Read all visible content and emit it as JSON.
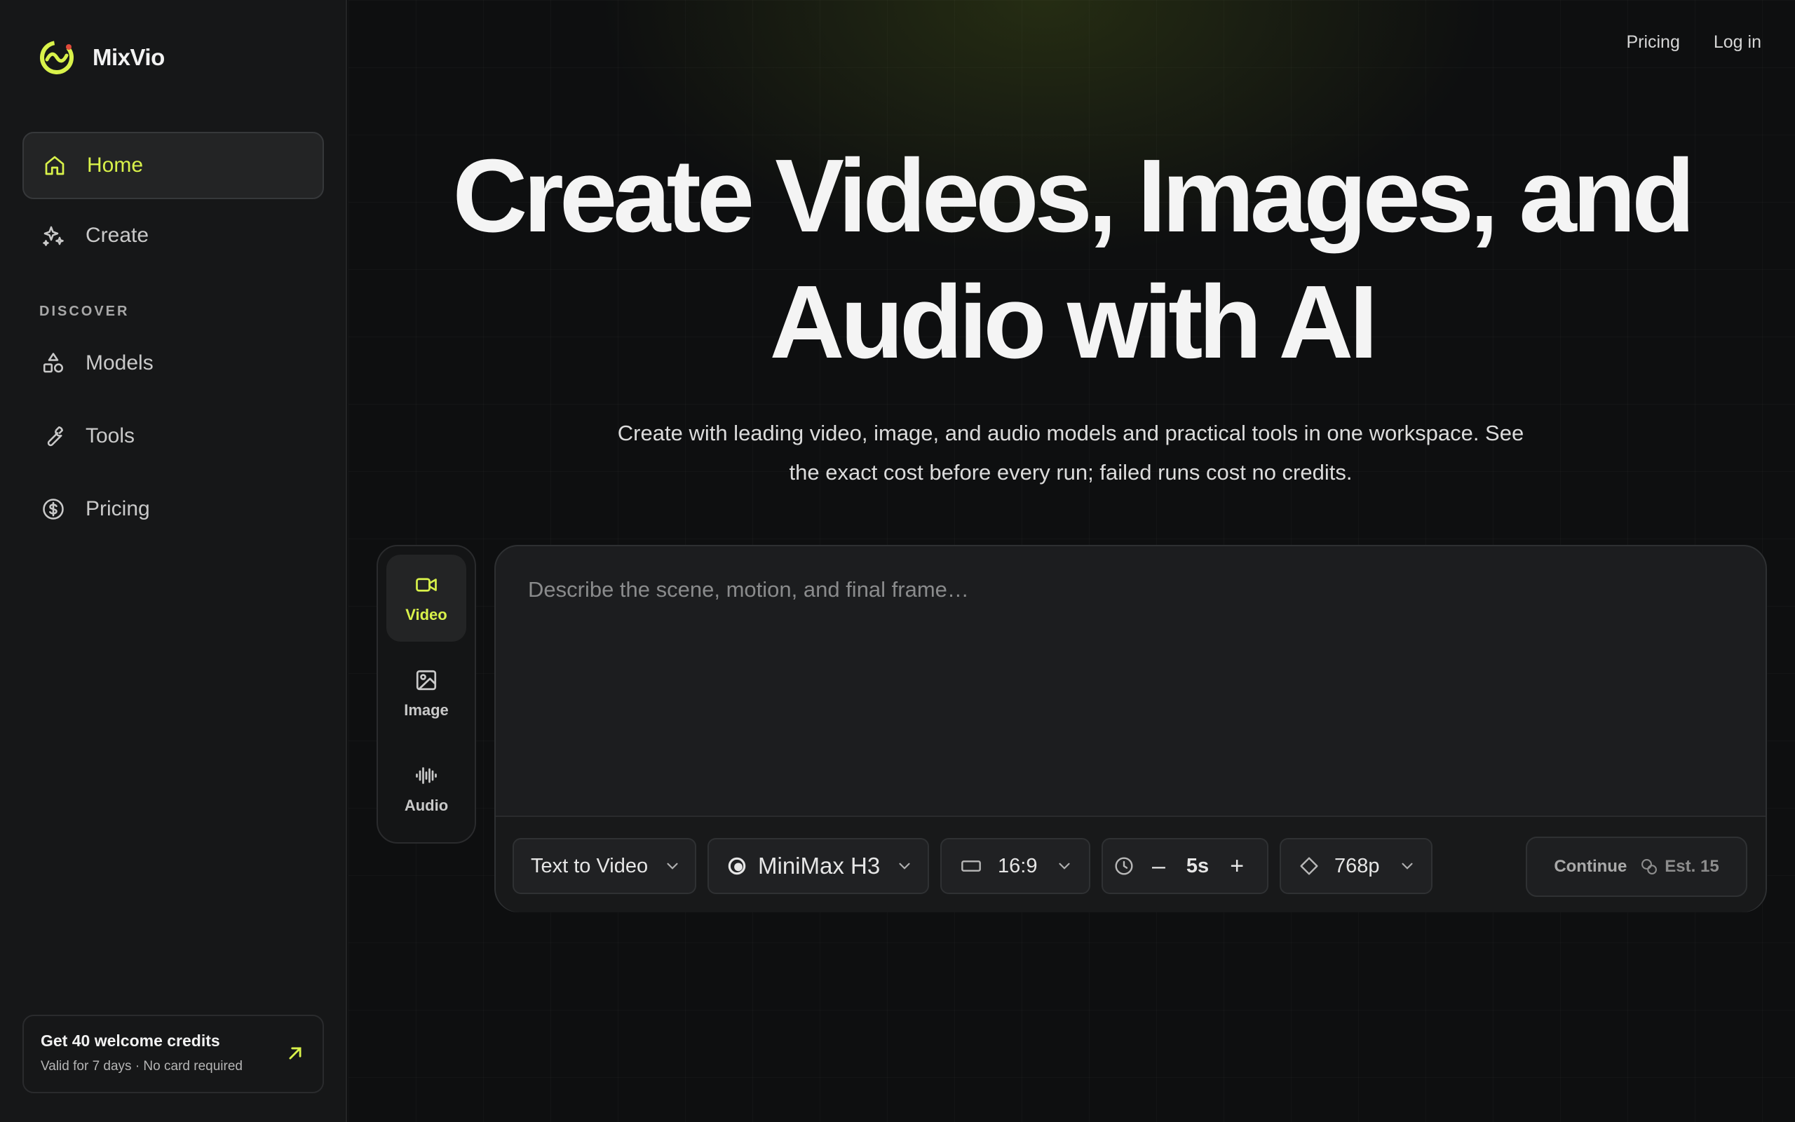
{
  "brand": {
    "name": "MixVio",
    "accent": "#d9f24a"
  },
  "sidebar": {
    "items": [
      {
        "label": "Home",
        "icon": "home-icon",
        "active": true
      },
      {
        "label": "Create",
        "icon": "sparkle-icon",
        "active": false
      }
    ],
    "section_label": "DISCOVER",
    "discover_items": [
      {
        "label": "Models",
        "icon": "shapes-icon"
      },
      {
        "label": "Tools",
        "icon": "wrench-icon"
      },
      {
        "label": "Pricing",
        "icon": "dollar-icon"
      }
    ],
    "promo": {
      "title": "Get 40 welcome credits",
      "subtitle": "Valid for 7 days · No card required"
    }
  },
  "topnav": {
    "pricing": "Pricing",
    "login": "Log in"
  },
  "hero": {
    "title_line1": "Create Videos, Images, and",
    "title_line2": "Audio with AI",
    "subtitle_line1": "Create with leading video, image, and audio models and practical tools in one workspace. See",
    "subtitle_line2": "the exact cost before every run; failed runs cost no credits."
  },
  "modes": [
    {
      "label": "Video",
      "icon": "video-camera-icon",
      "active": true
    },
    {
      "label": "Image",
      "icon": "image-icon",
      "active": false
    },
    {
      "label": "Audio",
      "icon": "waveform-icon",
      "active": false
    }
  ],
  "prompt": {
    "placeholder": "Describe the scene, motion, and final frame…",
    "value": ""
  },
  "toolbar": {
    "mode_select": "Text to Video",
    "model_select": "MiniMax H3",
    "aspect_ratio": "16:9",
    "duration": "5s",
    "resolution": "768p",
    "continue_label": "Continue",
    "estimate": "Est. 15"
  }
}
